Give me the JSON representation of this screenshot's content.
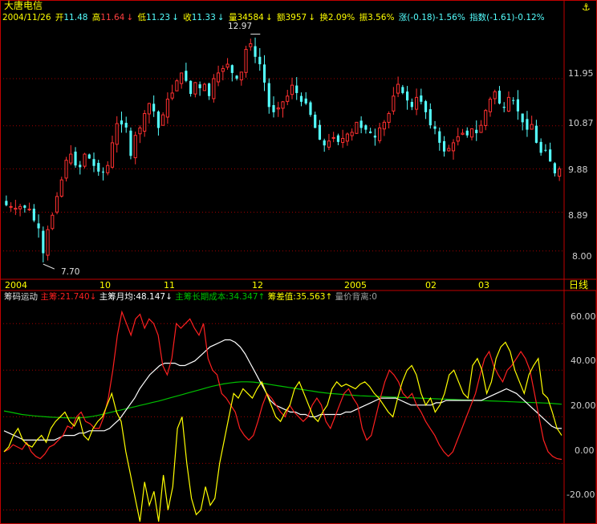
{
  "stock": {
    "name": "大唐电信",
    "date": "2004/11/26",
    "open": "11.48",
    "high": "11.64",
    "low": "11.23",
    "close": "11.33",
    "volume": "34584",
    "amount": "3957",
    "turnover": "2.09%",
    "amplitude": "3.56%",
    "change": "(-0.18)-1.56%",
    "index": "(-1.61)-0.12%",
    "labels": {
      "open": "开",
      "high": "高",
      "low": "低",
      "close": "收",
      "volume": "量",
      "amount": "额",
      "turnover": "换",
      "amplitude": "振",
      "change": "涨",
      "index": "指数"
    },
    "max_label": "12.97",
    "min_label": "7.70"
  },
  "upper_axis": [
    "11.95",
    "10.87",
    "9.88",
    "8.89",
    "8.00"
  ],
  "lower_axis": [
    "60.00",
    "40.00",
    "20.00",
    "0.00",
    "-20.00"
  ],
  "time_axis": {
    "labels": [
      "2004",
      "10",
      "11",
      "12",
      "2005",
      "02",
      "03"
    ],
    "period_button": "日线"
  },
  "indicator": {
    "name": "筹码运动",
    "items": [
      {
        "label": "主筹:",
        "value": "21.740",
        "arrow": "↓",
        "color": "#ff2020"
      },
      {
        "label": "主筹月均:",
        "value": "48.147",
        "arrow": "↓",
        "color": "#ffffff"
      },
      {
        "label": "主筹长期成本:",
        "value": "34.347",
        "arrow": "↑",
        "color": "#00c000"
      },
      {
        "label": "筹差值:",
        "value": "35.563",
        "arrow": "↑",
        "color": "#ffff00"
      },
      {
        "label": "量价背离:",
        "value": "0",
        "arrow": "",
        "color": "#a0a0a0"
      }
    ]
  },
  "colors": {
    "up": "#ff3030",
    "down": "#54ffff",
    "grid": "#a00000",
    "frame": "#c00000",
    "ma30": "#00c000",
    "main": "#ff2020",
    "monthly": "#ffffff",
    "diff": "#ffff00"
  },
  "chart_data": [
    {
      "type": "candlestick",
      "title": "大唐电信",
      "ylim": [
        7.5,
        13.2
      ],
      "yticks": [
        8.0,
        8.89,
        9.88,
        10.87,
        11.95
      ],
      "close": [
        9.05,
        9.02,
        8.98,
        9.02,
        8.99,
        8.96,
        8.7,
        8.52,
        7.95,
        8.49,
        8.82,
        9.25,
        9.63,
        10.08,
        10.22,
        9.96,
        9.92,
        10.22,
        10.12,
        9.95,
        9.82,
        9.8,
        9.96,
        10.48,
        10.92,
        10.9,
        10.83,
        10.18,
        10.65,
        10.82,
        11.15,
        11.38,
        11.2,
        10.82,
        11.12,
        11.48,
        11.62,
        11.9,
        12.08,
        11.9,
        11.6,
        11.86,
        11.73,
        11.82,
        11.55,
        11.95,
        12.08,
        12.18,
        12.28,
        12.08,
        11.95,
        12.1,
        12.62,
        12.75,
        12.45,
        12.28,
        11.86,
        11.3,
        11.18,
        11.28,
        11.42,
        11.55,
        11.8,
        11.62,
        11.42,
        11.38,
        11.12,
        10.82,
        10.55,
        10.42,
        10.52,
        10.6,
        10.5,
        10.58,
        10.68,
        10.72,
        10.95,
        10.82,
        10.78,
        10.7,
        10.6,
        10.82,
        10.95,
        11.15,
        11.55,
        11.82,
        11.62,
        11.45,
        11.3,
        11.52,
        11.42,
        11.18,
        10.88,
        10.8,
        10.48,
        10.28,
        10.35,
        10.48,
        10.62,
        10.7,
        10.65,
        10.8,
        10.7,
        10.88,
        11.22,
        11.48,
        11.65,
        11.38,
        11.28,
        11.52,
        11.45,
        11.2,
        10.95,
        10.78,
        10.9,
        10.48,
        10.25,
        10.3,
        10.05,
        9.78,
        9.88
      ],
      "markers": {
        "max": 12.97,
        "min": 7.7
      }
    },
    {
      "type": "line",
      "title": "筹码运动",
      "ylim": [
        -25,
        68
      ],
      "yticks": [
        -20,
        0,
        20,
        40,
        60
      ],
      "series": [
        {
          "name": "主筹",
          "values": [
            5,
            6,
            8,
            7,
            6,
            9,
            5,
            3,
            2,
            4,
            7,
            8,
            10,
            12,
            16,
            15,
            20,
            22,
            18,
            17,
            15,
            15,
            20,
            28,
            40,
            55,
            65,
            60,
            55,
            62,
            64,
            58,
            62,
            60,
            55,
            42,
            38,
            45,
            60,
            58,
            60,
            62,
            58,
            55,
            60,
            45,
            40,
            38,
            30,
            28,
            25,
            22,
            15,
            12,
            10,
            12,
            18,
            25,
            30,
            28,
            25,
            22,
            20,
            25,
            22,
            20,
            18,
            20,
            25,
            28,
            25,
            18,
            15,
            20,
            25,
            30,
            32,
            28,
            25,
            15,
            10,
            12,
            20,
            28,
            35,
            40,
            38,
            35,
            30,
            28,
            30,
            25,
            22,
            18,
            15,
            12,
            8,
            5,
            3,
            5,
            10,
            15,
            20,
            25,
            30,
            38,
            45,
            48,
            42,
            38,
            35,
            40,
            42,
            45,
            48,
            45,
            40,
            30,
            20,
            10,
            5,
            3,
            2,
            1.7
          ]
        },
        {
          "name": "主筹月均",
          "values": [
            14,
            13,
            12,
            11,
            10,
            10,
            10,
            10,
            10,
            10,
            10,
            11,
            12,
            12,
            12,
            13,
            13,
            14,
            14,
            14,
            14,
            15,
            17,
            19,
            22,
            25,
            28,
            32,
            35,
            38,
            40,
            42,
            43,
            43,
            43,
            42,
            42,
            43,
            44,
            46,
            48,
            50,
            51,
            52,
            53,
            53,
            52,
            50,
            47,
            43,
            39,
            35,
            31,
            27,
            25,
            24,
            23,
            22,
            22,
            21,
            21,
            20,
            20,
            21,
            21,
            21,
            21,
            21,
            22,
            22,
            23,
            24,
            25,
            26,
            27,
            28,
            28,
            28,
            28,
            27,
            26,
            25,
            25,
            25,
            25,
            25,
            26,
            26,
            27,
            27,
            27,
            27,
            27,
            27,
            27,
            27,
            28,
            29,
            30,
            31,
            32,
            31,
            30,
            28,
            26,
            24,
            22,
            20,
            18,
            16,
            15,
            15
          ]
        },
        {
          "name": "主筹长期成本",
          "values": [
            22.5,
            22,
            21.5,
            21,
            20.7,
            20.4,
            20.2,
            20,
            19.8,
            19.7,
            19.6,
            19.5,
            19.5,
            19.6,
            19.8,
            20.2,
            20.7,
            21.3,
            21.9,
            22.5,
            23.1,
            23.7,
            24.3,
            24.9,
            25.5,
            26.1,
            26.7,
            27.4,
            28.1,
            28.8,
            29.5,
            30.2,
            30.9,
            31.6,
            32.3,
            33,
            33.6,
            34.1,
            34.5,
            34.8,
            35,
            35,
            34.9,
            34.6,
            34.2,
            33.8,
            33.4,
            33,
            32.6,
            32.2,
            31.8,
            31.4,
            31,
            30.6,
            30.3,
            30,
            29.8,
            29.6,
            29.4,
            29.2,
            29,
            28.9,
            28.8,
            28.7,
            28.6,
            28.5,
            28.4,
            28.3,
            28.2,
            28.1,
            28,
            27.9,
            27.8,
            27.7,
            27.6,
            27.5,
            27.4,
            27.3,
            27.2,
            27.1,
            27,
            26.9,
            26.8,
            26.7,
            26.6,
            26.5,
            26.4,
            26.3,
            26.2,
            26.1,
            26,
            25.9,
            25.8,
            25.6,
            25.4
          ]
        },
        {
          "name": "筹差值",
          "values": [
            5,
            7,
            12,
            15,
            10,
            8,
            7,
            10,
            12,
            9,
            15,
            18,
            20,
            22,
            18,
            16,
            20,
            12,
            10,
            15,
            18,
            20,
            25,
            30,
            22,
            18,
            5,
            -5,
            -15,
            -25,
            -8,
            -18,
            -12,
            -25,
            -5,
            -20,
            -10,
            15,
            20,
            0,
            -15,
            -22,
            -20,
            -10,
            -18,
            -15,
            0,
            10,
            20,
            30,
            28,
            32,
            30,
            28,
            32,
            35,
            30,
            25,
            20,
            18,
            22,
            25,
            32,
            35,
            30,
            25,
            20,
            18,
            22,
            25,
            32,
            35,
            33,
            34,
            33,
            32,
            34,
            35,
            33,
            30,
            28,
            25,
            22,
            20,
            28,
            35,
            40,
            42,
            38,
            30,
            25,
            28,
            22,
            25,
            30,
            38,
            40,
            35,
            30,
            28,
            42,
            45,
            40,
            30,
            35,
            45,
            50,
            52,
            48,
            40,
            35,
            30,
            38,
            42,
            45,
            30,
            28,
            22,
            15,
            12
          ]
        }
      ],
      "current_values": {
        "主筹": 21.74,
        "主筹月均": 48.147,
        "主筹长期成本": 34.347,
        "筹差值": 35.563,
        "量价背离": 0
      }
    }
  ]
}
